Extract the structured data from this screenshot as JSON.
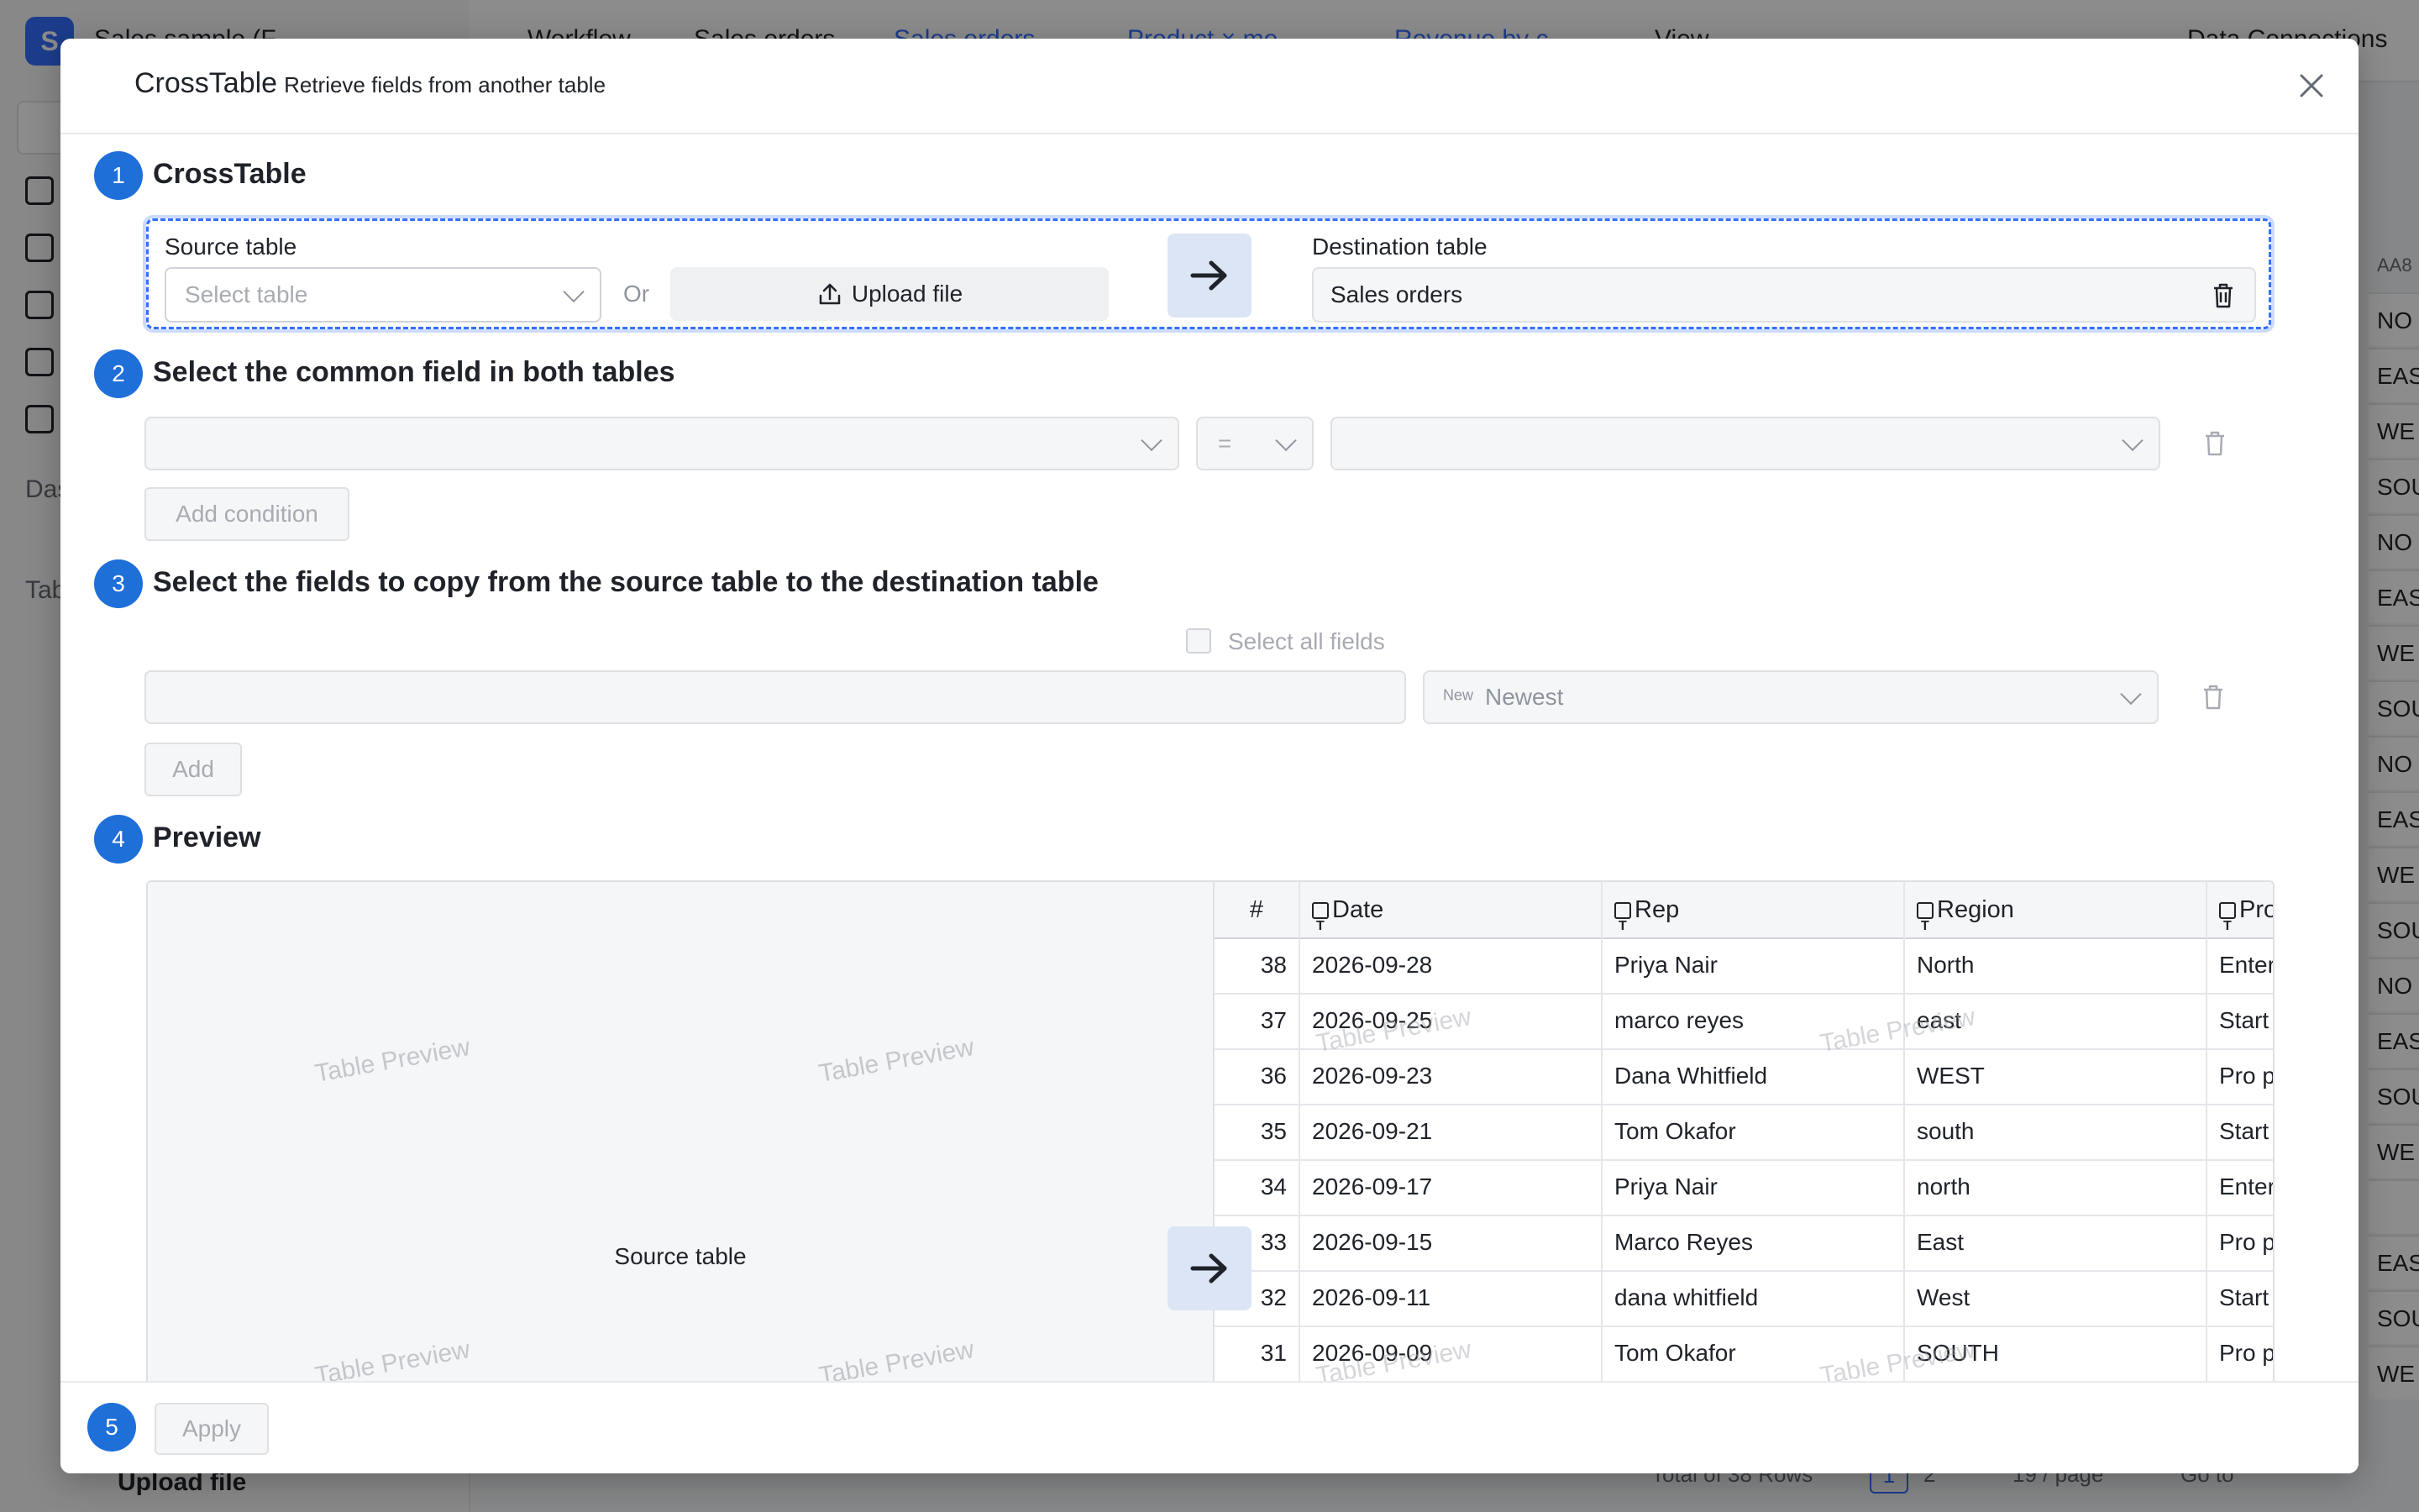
{
  "background": {
    "app_logo": "S",
    "app_title": "Sales sample (F",
    "tabs": [
      "Workflow",
      "Sales orders",
      "Sales orders",
      "Product × mo",
      "Revenue by c",
      "View"
    ],
    "top_right": "Data Connections",
    "sidebar_items": [
      "Das",
      "Tab"
    ],
    "grid_header": "AA8",
    "grid_cells": [
      "NO",
      "EAS",
      "WE",
      "SOU",
      "NO",
      "EAS",
      "WE",
      "SOU",
      "NO",
      "EAS",
      "WE",
      "SOU",
      "NO",
      "EAS",
      "SOU",
      "WE",
      "",
      "EAS",
      "SOU",
      "WE"
    ],
    "upload_file": "Upload file",
    "pager": {
      "total": "Total of 38 Rows",
      "page1": "1",
      "page2": "2",
      "page_size": "19 / page",
      "goto": "Go to"
    }
  },
  "modal": {
    "title": "CrossTable",
    "subtitle": "Retrieve fields from another table",
    "close_icon": "close-icon"
  },
  "step1": {
    "num": "1",
    "title": "CrossTable",
    "source_label": "Source table",
    "source_placeholder": "Select table",
    "or": "Or",
    "upload_label": "Upload file",
    "dest_label": "Destination table",
    "dest_value": "Sales orders"
  },
  "step2": {
    "num": "2",
    "title": "Select the common field in both tables",
    "operator": "=",
    "add_condition": "Add condition"
  },
  "step3": {
    "num": "3",
    "title": "Select the fields to copy from the source table to the destination table",
    "select_all": "Select all fields",
    "mode_tag": "New",
    "mode_value": "Newest",
    "add": "Add"
  },
  "step4": {
    "num": "4",
    "title": "Preview",
    "source_label": "Source table",
    "watermark": "Table Preview",
    "columns": [
      "#",
      "Date",
      "Rep",
      "Region",
      "Prod"
    ],
    "rows": [
      [
        "38",
        "2026-09-28",
        "Priya Nair",
        "North",
        "Enter"
      ],
      [
        "37",
        "2026-09-25",
        "marco reyes",
        "east",
        "Start"
      ],
      [
        "36",
        "2026-09-23",
        "Dana Whitfield",
        "WEST",
        "Pro p"
      ],
      [
        "35",
        "2026-09-21",
        "Tom Okafor",
        "south",
        "Start"
      ],
      [
        "34",
        "2026-09-17",
        "Priya Nair",
        "north",
        "Enter"
      ],
      [
        "33",
        "2026-09-15",
        "Marco Reyes",
        "East",
        "Pro p"
      ],
      [
        "32",
        "2026-09-11",
        "dana whitfield",
        "West",
        "Start"
      ],
      [
        "31",
        "2026-09-09",
        "Tom Okafor",
        "SOUTH",
        "Pro p"
      ]
    ]
  },
  "step5": {
    "num": "5",
    "apply": "Apply"
  },
  "colors": {
    "accent": "#1f6fd9",
    "link": "#3370ff",
    "arrow_bg": "#dbe5f6"
  }
}
